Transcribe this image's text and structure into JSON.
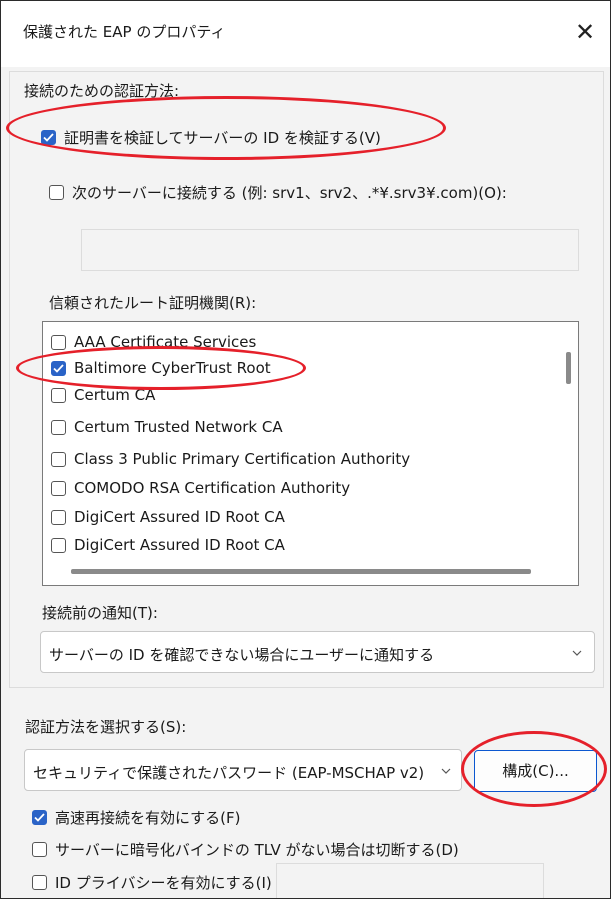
{
  "window": {
    "title": "保護された EAP のプロパティ",
    "close_glyph": "✕"
  },
  "auth_method_section": {
    "heading": "接続のための認証方法:",
    "verify_server": {
      "label": "証明書を検証してサーバーの ID を検証する(V)",
      "checked": true
    },
    "connect_servers": {
      "label": "次のサーバーに接続する (例: srv1、srv2、.*¥.srv3¥.com)(O):",
      "checked": false,
      "value": ""
    },
    "trusted_root_label": "信頼されたルート証明機関(R):",
    "trusted_roots": [
      {
        "label": "AAA Certificate Services",
        "checked": false
      },
      {
        "label": "Baltimore CyberTrust Root",
        "checked": true
      },
      {
        "label": "Certum CA",
        "checked": false
      },
      {
        "label": "Certum Trusted Network CA",
        "checked": false
      },
      {
        "label": "Class 3 Public Primary Certification Authority",
        "checked": false
      },
      {
        "label": "COMODO RSA Certification Authority",
        "checked": false
      },
      {
        "label": "DigiCert Assured ID Root CA",
        "checked": false
      },
      {
        "label": "DigiCert Assured ID Root CA",
        "checked": false
      }
    ],
    "notify_label": "接続前の通知(T):",
    "notify_value": "サーバーの ID を確認できない場合にユーザーに通知する"
  },
  "select_method": {
    "label": "認証方法を選択する(S):",
    "value": "セキュリティで保護されたパスワード (EAP-MSCHAP v2)",
    "configure_button": "構成(C)..."
  },
  "options": {
    "fast_reconnect": {
      "label": "高速再接続を有効にする(F)",
      "checked": true
    },
    "disconnect_no_tlv": {
      "label": "サーバーに暗号化バインドの TLV がない場合は切断する(D)",
      "checked": false
    },
    "id_privacy": {
      "label": "ID プライバシーを有効にする(I)",
      "checked": false,
      "value": ""
    }
  },
  "annotations": {
    "highlight_color": "#e5202a"
  },
  "colors": {
    "accent": "#2a63c7",
    "button_border": "#0b57d0"
  }
}
